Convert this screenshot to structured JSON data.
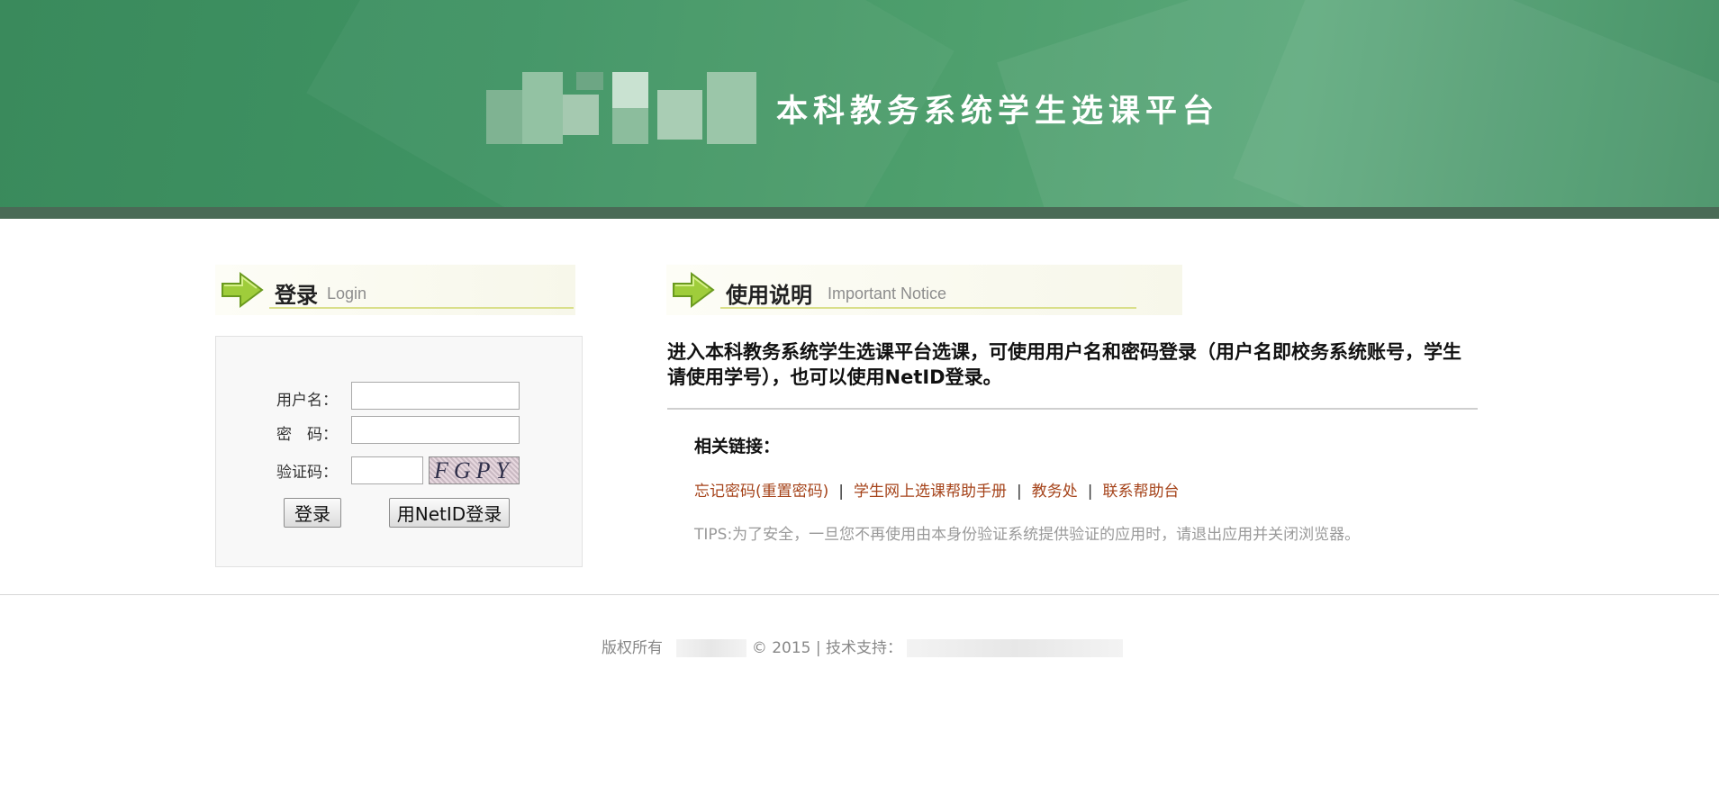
{
  "header": {
    "system_title": "本科教务系统学生选课平台"
  },
  "login_section": {
    "title_cn": "登录",
    "title_en": "Login",
    "username_label": "用户名：",
    "username_value": "",
    "password_label": "密　码：",
    "password_value": "",
    "captcha_label": "验证码：",
    "captcha_value": "",
    "captcha_image_text": "FGPY",
    "login_button": "登录",
    "netid_button": "用NetID登录"
  },
  "notice_section": {
    "title_cn": "使用说明",
    "title_en": "Important Notice",
    "text": "进入本科教务系统学生选课平台选课，可使用用户名和密码登录（用户名即校务系统账号，学生请使用学号），也可以使用NetID登录。",
    "links_title": "相关链接：",
    "links": [
      "忘记密码(重置密码)",
      "学生网上选课帮助手册",
      "教务处",
      "联系帮助台"
    ],
    "link_separator": "|",
    "tips": "TIPS:为了安全，一旦您不再使用由本身份验证系统提供验证的应用时，请退出应用并关闭浏览器。"
  },
  "footer": {
    "copyright_prefix": "版权所有",
    "year_text": "© 2015 | 技术支持："
  },
  "colors": {
    "banner_green": "#3f9363",
    "link": "#a5431a",
    "tips_gray": "#9a9a9a"
  }
}
